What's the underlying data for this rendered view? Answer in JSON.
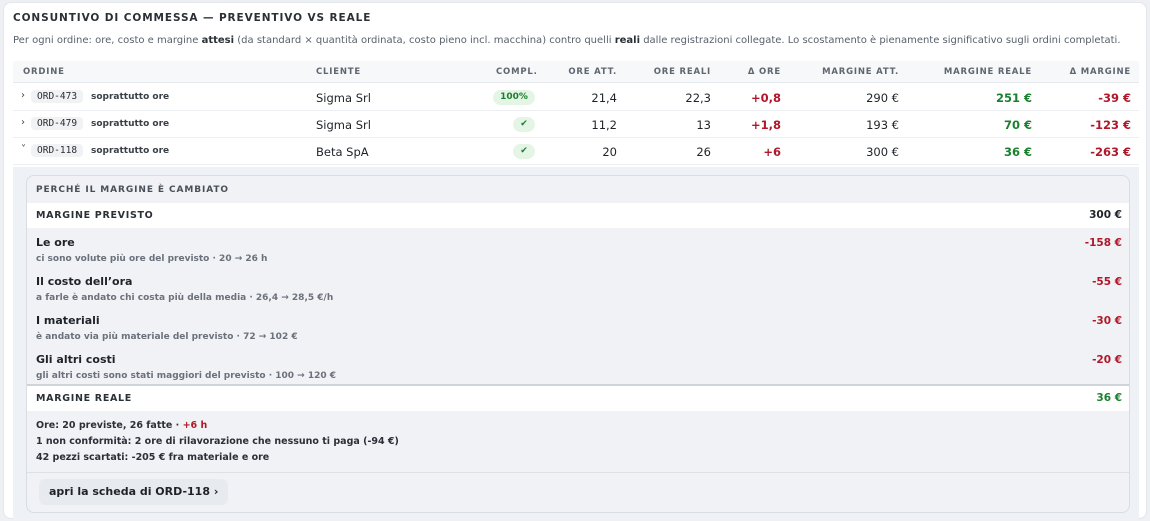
{
  "header": {
    "title": "CONSUNTIVO DI COMMESSA — PREVENTIVO VS REALE",
    "subtitle_pre": "Per ogni ordine: ore, costo e margine ",
    "subtitle_b1": "attesi",
    "subtitle_mid": " (da standard × quantità ordinata, costo pieno incl. macchina) contro quelli ",
    "subtitle_b2": "reali",
    "subtitle_post": " dalle registrazioni collegate. Lo scostamento è pienamente significativo sugli ordini completati."
  },
  "columns": [
    "ORDINE",
    "CLIENTE",
    "COMPL.",
    "ORE ATT.",
    "ORE REALI",
    "Δ ORE",
    "MARGINE ATT.",
    "MARGINE REALE",
    "Δ MARGINE"
  ],
  "rows": [
    {
      "chevron": "›",
      "code": "ORD-473",
      "tag": "soprattutto ore",
      "client": "Sigma Srl",
      "compl": "100%",
      "ore_att": "21,4",
      "ore_reali": "22,3",
      "delta_ore": "+0,8",
      "margine_att": "290 €",
      "margine_reale": "251 €",
      "delta_margine": "-39 €"
    },
    {
      "chevron": "›",
      "code": "ORD-479",
      "tag": "soprattutto ore",
      "client": "Sigma Srl",
      "compl": "✔",
      "ore_att": "11,2",
      "ore_reali": "13",
      "delta_ore": "+1,8",
      "margine_att": "193 €",
      "margine_reale": "70 €",
      "delta_margine": "-123 €"
    },
    {
      "chevron": "˅",
      "code": "ORD-118",
      "tag": "soprattutto ore",
      "client": "Beta SpA",
      "compl": "✔",
      "ore_att": "20",
      "ore_reali": "26",
      "delta_ore": "+6",
      "margine_att": "300 €",
      "margine_reale": "36 €",
      "delta_margine": "-263 €"
    }
  ],
  "detail": {
    "title": "PERCHÉ IL MARGINE È CAMBIATO",
    "expected_label": "MARGINE PREVISTO",
    "expected_value": "300 €",
    "factors": [
      {
        "name": "Le ore",
        "desc": "ci sono volute più ore del previsto · 20 → 26 h",
        "value": "-158 €"
      },
      {
        "name": "Il costo dell’ora",
        "desc": "a farle è andato chi costa più della media · 26,4 → 28,5 €/h",
        "value": "-55 €"
      },
      {
        "name": "I materiali",
        "desc": "è andato via più materiale del previsto · 72 → 102 €",
        "value": "-30 €"
      },
      {
        "name": "Gli altri costi",
        "desc": "gli altri costi sono stati maggiori del previsto · 100 → 120 €",
        "value": "-20 €"
      }
    ],
    "actual_label": "MARGINE REALE",
    "actual_value": "36 €",
    "note1_pre": "Ore: 20 previste, 26 fatte · ",
    "note1_delta": "+6 h",
    "note2": "1 non conformità: 2 ore di rilavorazione che nessuno ti paga (-94 €)",
    "note3": "42 pezzi scartati: -205 € fra materiale e ore",
    "open_button": "apri la scheda di ORD-118 ›"
  },
  "colors": {
    "negative": "#b0182a",
    "positive": "#1a7f2e",
    "panel": "#f0f2f6"
  }
}
